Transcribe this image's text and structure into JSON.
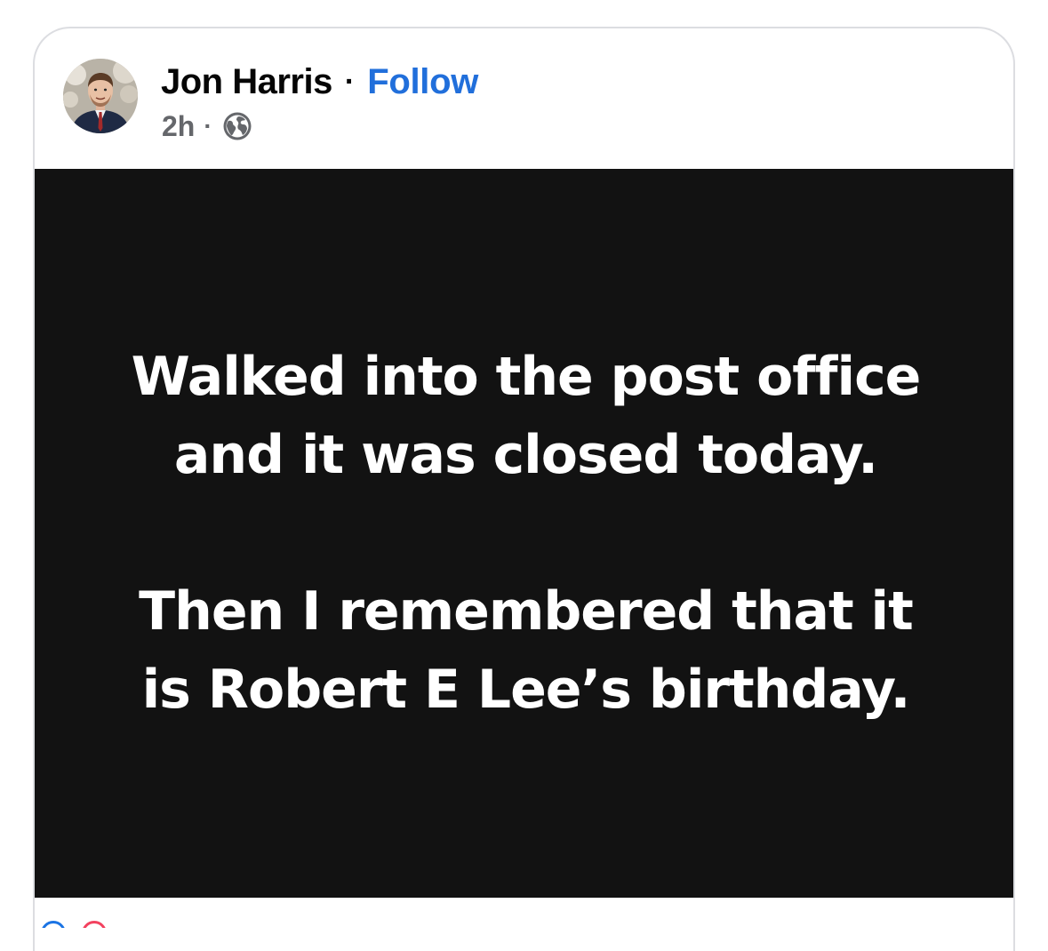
{
  "post": {
    "author": {
      "name": "Jon Harris",
      "avatar_icon": "person-avatar-icon"
    },
    "separator": "·",
    "follow_label": "Follow",
    "follow_color": "#216fdb",
    "timestamp": "2h",
    "meta_separator": "·",
    "audience_icon": "globe-icon",
    "body": {
      "background_color": "#121212",
      "text_color": "#ffffff",
      "paragraph_1": "Walked into the post office and it was closed today.",
      "paragraph_2": "Then I remembered that it is Robert E Lee’s birthday."
    }
  },
  "reactions": {
    "icons": [
      "like-icon",
      "love-icon"
    ]
  }
}
